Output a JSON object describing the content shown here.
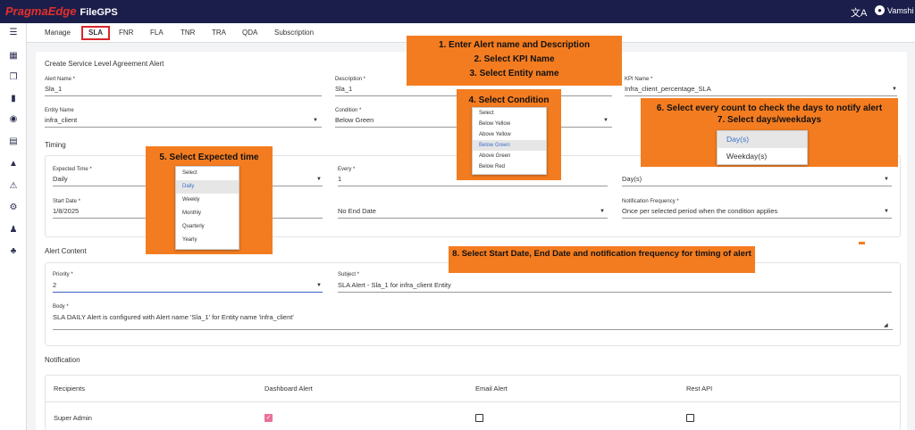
{
  "app": {
    "brand": "PragmaEdge",
    "product": "FileGPS",
    "user": "Vamshi",
    "translate_icon": "translate-icon",
    "user_icon": "account-icon"
  },
  "sidebar": [
    "menu-icon",
    "dashboard-icon",
    "copy-icon",
    "bar-chart-icon",
    "account-circle-icon",
    "document-icon",
    "alert-icon",
    "alert-settings-icon",
    "tools-icon",
    "user-settings-icon",
    "group-icon"
  ],
  "tabs": [
    "Manage",
    "SLA",
    "FNR",
    "FLA",
    "TNR",
    "TRA",
    "QDA",
    "Subscription"
  ],
  "active_tab": "SLA",
  "form": {
    "title": "Create Service Level Agreement Alert",
    "alert_name_label": "Alert Name *",
    "alert_name_value": "Sla_1",
    "description_label": "Description *",
    "description_value": "Sla_1",
    "kpi_label": "KPI Name *",
    "kpi_value": "Infra_client_percentage_SLA",
    "entity_label": "Entity Name",
    "entity_value": "infra_client",
    "condition_label": "Condition *",
    "condition_value": "Below Green"
  },
  "timing": {
    "title": "Timing",
    "expected_label": "Expected Time *",
    "expected_value": "Daily",
    "every_label": "Every *",
    "every_value": "1",
    "unit_value": "Day(s)",
    "start_label": "Start Date *",
    "start_value": "1/8/2025",
    "end_value": "No End Date",
    "freq_label": "Notification Frequency *",
    "freq_value": "Once per selected period when the condition applies"
  },
  "content": {
    "title": "Alert Content",
    "priority_label": "Priority *",
    "priority_value": "2",
    "subject_label": "Subject *",
    "subject_value": "SLA Alert - Sla_1 for infra_client Entity",
    "body_label": "Body *",
    "body_value": "SLA DAILY Alert is configured with Alert name 'Sla_1' for Entity name 'infra_client'"
  },
  "notification": {
    "title": "Notification",
    "headers": [
      "Recipients",
      "Dashboard Alert",
      "Email Alert",
      "Rest API"
    ],
    "row": {
      "recipient": "Super Admin",
      "dashboard": true,
      "email": false,
      "rest": false
    }
  },
  "dropdowns": {
    "condition_options": [
      "Select",
      "Below Yellow",
      "Above Yellow",
      "Below Green",
      "Above Green",
      "Below Red"
    ],
    "condition_selected": "Below Green",
    "expected_options": [
      "Select",
      "Daily",
      "Weekly",
      "Monthly",
      "Quarterly",
      "Yearly"
    ],
    "expected_selected": "Daily",
    "unit_options": [
      "Day(s)",
      "Weekday(s)"
    ],
    "unit_selected": "Day(s)"
  },
  "callouts": {
    "c1": "1. Enter Alert name and Description",
    "c2": "2. Select KPI Name",
    "c3": "3. Select Entity name",
    "c4": "4. Select Condition",
    "c5": "5. Select Expected time",
    "c6": "6. Select every count to check the days to notify alert",
    "c7": "7. Select days/weekdays",
    "c8": "8. Select Start Date, End Date and notification frequency for timing of alert"
  },
  "colors": {
    "topbar": "#1b1e4b",
    "brand_red": "#e5302a",
    "callout": "#f47c20",
    "active_tab_border": "#d9262b",
    "checkbox_on": "#e8709a",
    "priority_underline": "#3b5fc8"
  }
}
